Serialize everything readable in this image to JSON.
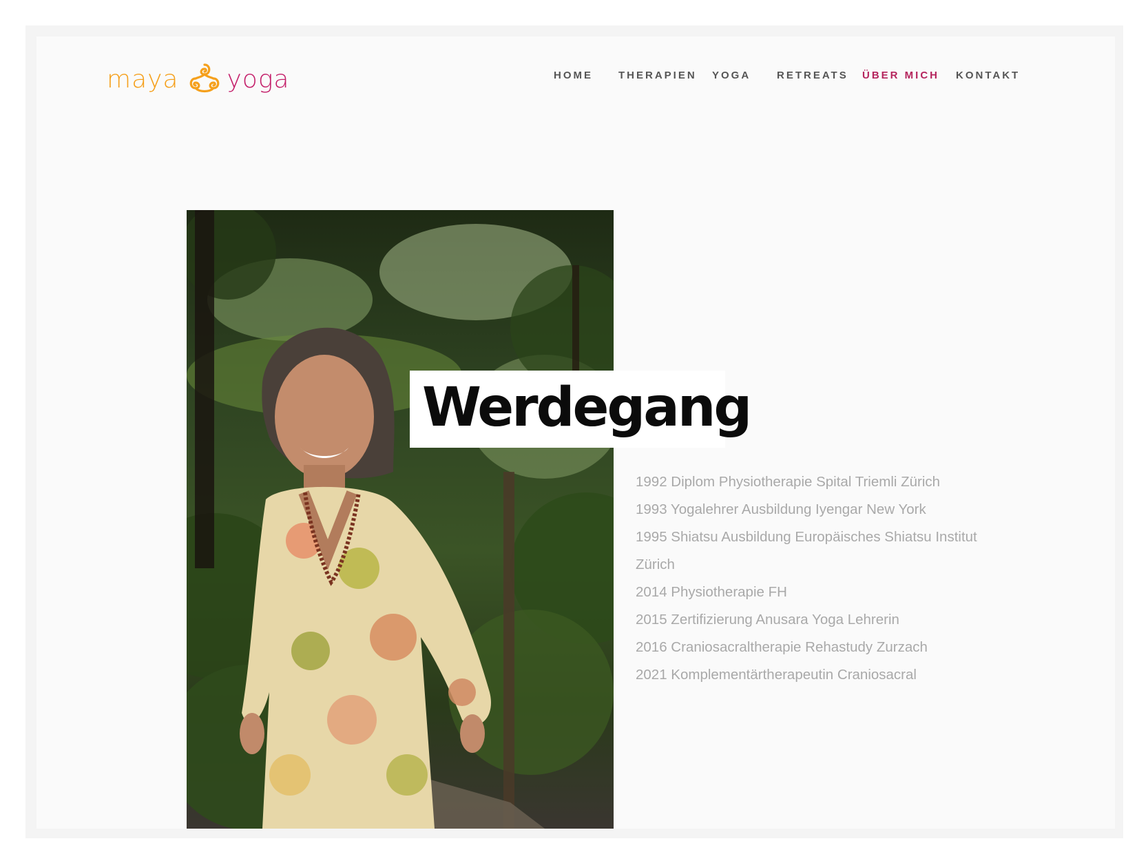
{
  "brand": {
    "logo_left": "maya",
    "logo_right": "yoga",
    "colors": {
      "orange": "#f5a01c",
      "magenta": "#c41f6a"
    },
    "mark_icon": "triple-spiral-icon"
  },
  "nav": {
    "items": [
      {
        "label": "HOME",
        "active": false
      },
      {
        "label": "THERAPIEN",
        "active": false
      },
      {
        "label": "YOGA",
        "active": false
      },
      {
        "label": "RETREATS",
        "active": false
      },
      {
        "label": "ÜBER MICH",
        "active": true
      },
      {
        "label": "KONTAKT",
        "active": false
      }
    ],
    "active_color": "#b5245d"
  },
  "main": {
    "heading": "Werdegang",
    "timeline": [
      "1992 Diplom Physiotherapie Spital Triemli Zürich",
      "1993 Yogalehrer Ausbildung Iyengar New York",
      "1995 Shiatsu Ausbildung Europäisches Shiatsu Institut",
      "Zürich",
      "2014 Physiotherapie FH",
      "2015 Zertifizierung Anusara Yoga Lehrerin",
      "2016 Craniosacraltherapie Rehastudy Zurzach",
      "2021 Komplementärtherapeutin Craniosacral"
    ]
  }
}
